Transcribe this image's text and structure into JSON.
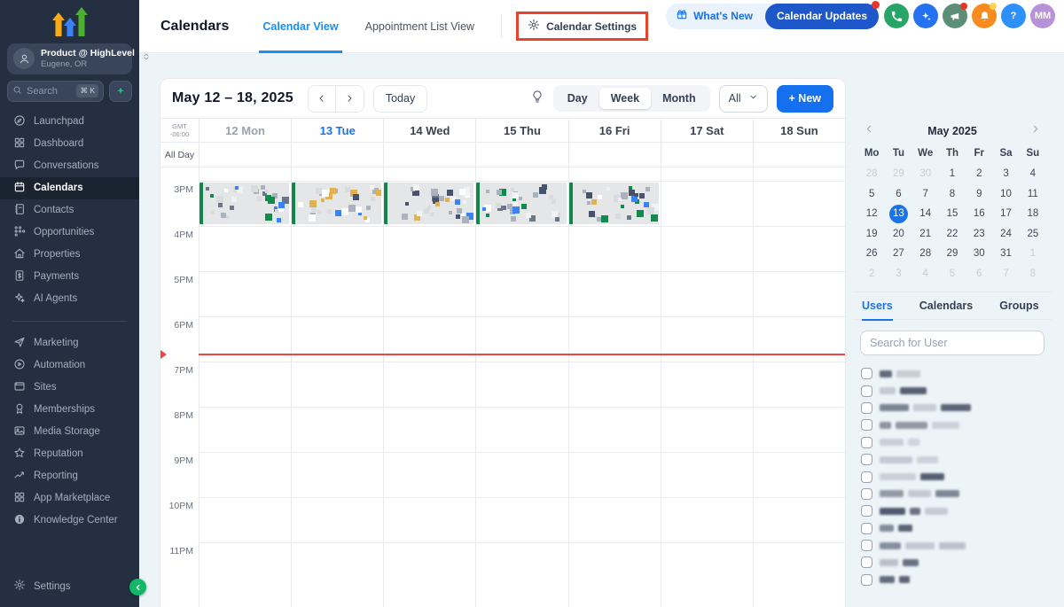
{
  "colors": {
    "accent_blue": "#1570ef",
    "tab_blue": "#1890f5",
    "today_blue": "#1a73e8",
    "highlight_red": "#e8432e",
    "now_line_red": "#ef4444",
    "event_green": "#12864c",
    "sidebar_bg": "#243041",
    "collapse_green": "#12b76a"
  },
  "app": {
    "logo": "highlevel-arrows-logo",
    "account": {
      "name": "Product @ HighLevel",
      "location": "Eugene, OR"
    },
    "search": {
      "placeholder": "Search",
      "shortcut": "⌘ K"
    }
  },
  "sidebar": {
    "items": [
      {
        "label": "Launchpad",
        "icon": "launchpad"
      },
      {
        "label": "Dashboard",
        "icon": "dashboard"
      },
      {
        "label": "Conversations",
        "icon": "conversations"
      },
      {
        "label": "Calendars",
        "icon": "calendar",
        "active": true
      },
      {
        "label": "Contacts",
        "icon": "contacts"
      },
      {
        "label": "Opportunities",
        "icon": "opportunities"
      },
      {
        "label": "Properties",
        "icon": "properties"
      },
      {
        "label": "Payments",
        "icon": "payments"
      },
      {
        "label": "AI Agents",
        "icon": "ai"
      },
      {
        "divider": true
      },
      {
        "label": "Marketing",
        "icon": "marketing"
      },
      {
        "label": "Automation",
        "icon": "automation"
      },
      {
        "label": "Sites",
        "icon": "sites"
      },
      {
        "label": "Memberships",
        "icon": "memberships"
      },
      {
        "label": "Media Storage",
        "icon": "media"
      },
      {
        "label": "Reputation",
        "icon": "reputation"
      },
      {
        "label": "Reporting",
        "icon": "reporting"
      },
      {
        "label": "App Marketplace",
        "icon": "marketplace"
      },
      {
        "label": "Knowledge Center",
        "icon": "knowledge"
      }
    ],
    "settings_label": "Settings"
  },
  "header": {
    "title": "Calendars",
    "tabs": [
      {
        "label": "Calendar View",
        "active": true
      },
      {
        "label": "Appointment List View",
        "active": false
      }
    ],
    "settings_button": "Calendar Settings",
    "whats_new_label": "What's New",
    "updates_badge": "Calendar Updates",
    "icon_buttons": [
      {
        "name": "phone",
        "color": "#27a567"
      },
      {
        "name": "ai-sparkle",
        "color": "#2471f2"
      },
      {
        "name": "megaphone",
        "color": "#5d8f78",
        "dot": "#e8332a"
      },
      {
        "name": "bell",
        "color": "#f68b1f",
        "dot": "#fdd34f"
      },
      {
        "name": "help",
        "color": "#2e90fa",
        "label": "?"
      },
      {
        "name": "avatar",
        "color": "#b792d8",
        "label": "MM"
      }
    ]
  },
  "toolbar": {
    "date_range": "May 12 – 18, 2025",
    "today_label": "Today",
    "views": [
      "Day",
      "Week",
      "Month"
    ],
    "active_view": "Week",
    "filter_label": "All",
    "new_label": "+ New"
  },
  "calendar": {
    "timezone_line1": "GMT",
    "timezone_line2": "-06:00",
    "all_day_label": "All Day",
    "days": [
      {
        "label": "12 Mon",
        "state": "past"
      },
      {
        "label": "13 Tue",
        "state": "today"
      },
      {
        "label": "14 Wed",
        "state": ""
      },
      {
        "label": "15 Thu",
        "state": ""
      },
      {
        "label": "16 Fri",
        "state": ""
      },
      {
        "label": "17 Sat",
        "state": ""
      },
      {
        "label": "18 Sun",
        "state": ""
      }
    ],
    "hours": [
      "3PM",
      "4PM",
      "5PM",
      "6PM",
      "7PM",
      "8PM",
      "9PM",
      "10PM",
      "11PM"
    ],
    "events": [
      {
        "day": 0,
        "redacted": true
      },
      {
        "day": 1,
        "redacted": true
      },
      {
        "day": 2,
        "redacted": true
      },
      {
        "day": 3,
        "redacted": true
      },
      {
        "day": 4,
        "redacted": true
      }
    ]
  },
  "mini_calendar": {
    "title": "May 2025",
    "weekdays": [
      "Mo",
      "Tu",
      "We",
      "Th",
      "Fr",
      "Sa",
      "Su"
    ],
    "cells": [
      {
        "d": 28,
        "muted": true
      },
      {
        "d": 29,
        "muted": true
      },
      {
        "d": 30,
        "muted": true
      },
      {
        "d": 1
      },
      {
        "d": 2
      },
      {
        "d": 3
      },
      {
        "d": 4
      },
      {
        "d": 5
      },
      {
        "d": 6
      },
      {
        "d": 7
      },
      {
        "d": 8
      },
      {
        "d": 9
      },
      {
        "d": 10
      },
      {
        "d": 11
      },
      {
        "d": 12
      },
      {
        "d": 13,
        "selected": true
      },
      {
        "d": 14
      },
      {
        "d": 15
      },
      {
        "d": 16
      },
      {
        "d": 17
      },
      {
        "d": 18
      },
      {
        "d": 19
      },
      {
        "d": 20
      },
      {
        "d": 21
      },
      {
        "d": 22
      },
      {
        "d": 23
      },
      {
        "d": 24
      },
      {
        "d": 25
      },
      {
        "d": 26
      },
      {
        "d": 27
      },
      {
        "d": 28
      },
      {
        "d": 29
      },
      {
        "d": 30
      },
      {
        "d": 31
      },
      {
        "d": 1,
        "muted": true
      },
      {
        "d": 2,
        "muted": true
      },
      {
        "d": 3,
        "muted": true
      },
      {
        "d": 4,
        "muted": true
      },
      {
        "d": 5,
        "muted": true
      },
      {
        "d": 6,
        "muted": true
      },
      {
        "d": 7,
        "muted": true
      },
      {
        "d": 8,
        "muted": true
      }
    ]
  },
  "right_panel": {
    "tabs": [
      {
        "label": "Users",
        "active": true
      },
      {
        "label": "Calendars",
        "active": false
      },
      {
        "label": "Groups",
        "active": false
      }
    ],
    "search_placeholder": "Search for User",
    "user_rows": 13
  }
}
